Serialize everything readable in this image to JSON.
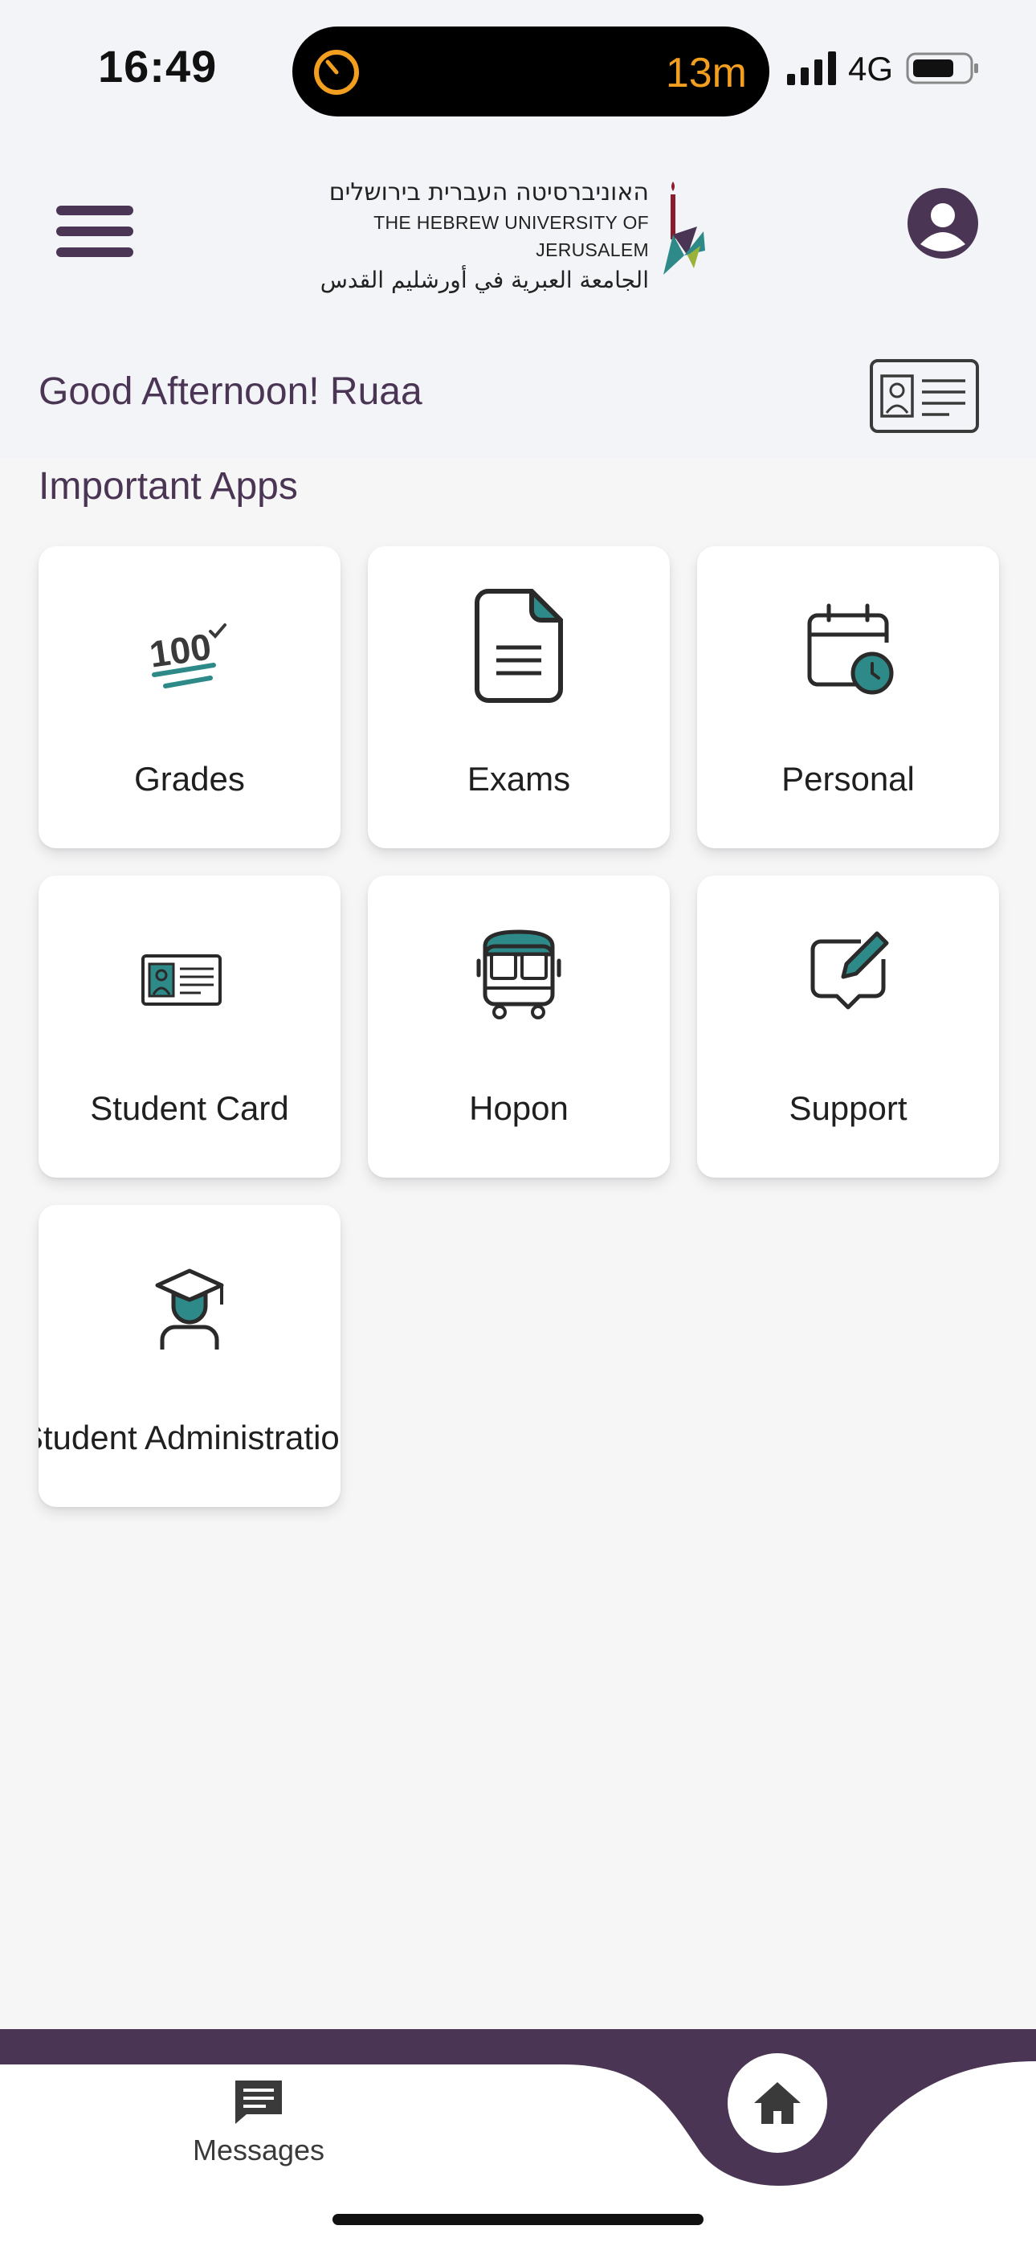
{
  "status_bar": {
    "time": "16:49",
    "live_activity_timer": "13m",
    "network": "4G"
  },
  "header": {
    "logo": {
      "hebrew": "האוניברסיטה העברית בירושלים",
      "english": "THE HEBREW UNIVERSITY OF JERUSALEM",
      "arabic": "الجامعة العبرية في أورشليم القدس"
    },
    "greeting": "Good Afternoon! Ruaa"
  },
  "section": {
    "title": "Important Apps"
  },
  "apps": [
    {
      "label": "Grades",
      "icon": "grades-100-icon"
    },
    {
      "label": "Exams",
      "icon": "document-icon"
    },
    {
      "label": "Personal",
      "icon": "calendar-clock-icon"
    },
    {
      "label": "Student Card",
      "icon": "id-card-icon"
    },
    {
      "label": "Hopon",
      "icon": "bus-icon"
    },
    {
      "label": "Support",
      "icon": "chat-edit-icon"
    },
    {
      "label": "Student Administration",
      "icon": "graduate-icon"
    }
  ],
  "bottom_nav": {
    "messages_label": "Messages"
  },
  "colors": {
    "brand_purple": "#4b3554",
    "teal": "#2e8a88",
    "accent_orange": "#f29e1e",
    "background": "#f6f6f7"
  }
}
